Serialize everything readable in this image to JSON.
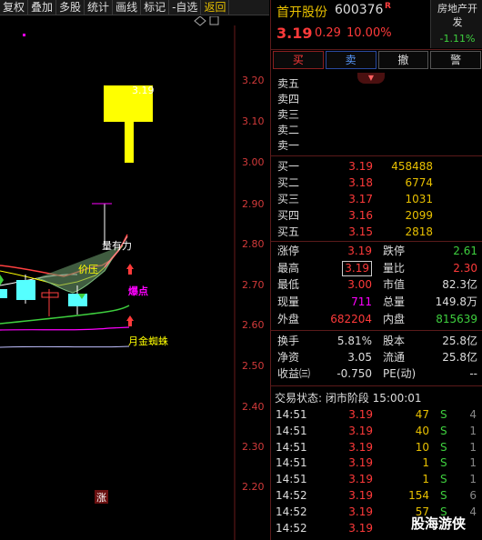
{
  "toolbar": {
    "items": [
      "复权",
      "叠加",
      "多股",
      "统计",
      "画线",
      "标记",
      "-自选",
      "返回"
    ]
  },
  "chart": {
    "price_labels": [
      "3.20",
      "3.10",
      "3.00",
      "2.90",
      "2.80",
      "2.70",
      "2.60",
      "2.50",
      "2.40",
      "2.30",
      "2.20"
    ],
    "high_label": "3.19",
    "annotations": {
      "volume": "量有力",
      "pressure": "价压",
      "burst": "爆点",
      "spider": "月金蜘蛛",
      "limit_up": "涨"
    },
    "colors": {
      "up_candle": "#ffff00",
      "down_candle": "#55ffff",
      "magenta": "#ff00ff"
    }
  },
  "header": {
    "name": "首开股份",
    "code": "600376",
    "badge": "R",
    "price": "3.19",
    "change": "0.29",
    "change_pct": "10.00%",
    "sector_name": "房地产开发",
    "sector_pct": "-1.11%"
  },
  "actions": {
    "buy": "买",
    "sell": "卖",
    "cancel": "撤",
    "alert": "警"
  },
  "asks": [
    {
      "label": "卖五",
      "price": "",
      "vol": ""
    },
    {
      "label": "卖四",
      "price": "",
      "vol": ""
    },
    {
      "label": "卖三",
      "price": "",
      "vol": ""
    },
    {
      "label": "卖二",
      "price": "",
      "vol": ""
    },
    {
      "label": "卖一",
      "price": "",
      "vol": ""
    }
  ],
  "bids": [
    {
      "label": "买一",
      "price": "3.19",
      "vol": "458488"
    },
    {
      "label": "买二",
      "price": "3.18",
      "vol": "6774"
    },
    {
      "label": "买三",
      "price": "3.17",
      "vol": "1031"
    },
    {
      "label": "买四",
      "price": "3.16",
      "vol": "2099"
    },
    {
      "label": "买五",
      "price": "3.15",
      "vol": "2818"
    }
  ],
  "stats": {
    "limit_up_label": "涨停",
    "limit_up": "3.19",
    "limit_down_label": "跌停",
    "limit_down": "2.61",
    "high_label": "最高",
    "high": "3.19",
    "vol_ratio_label": "量比",
    "vol_ratio": "2.30",
    "low_label": "最低",
    "low": "3.00",
    "mcap_label": "市值",
    "mcap": "82.3亿",
    "cur_vol_label": "现量",
    "cur_vol": "711",
    "total_vol_label": "总量",
    "total_vol": "149.8万",
    "outer_label": "外盘",
    "outer": "682204",
    "inner_label": "内盘",
    "inner": "815639",
    "turnover_label": "换手",
    "turnover": "5.81%",
    "shares_label": "股本",
    "shares": "25.8亿",
    "nav_label": "净资",
    "nav": "3.05",
    "float_label": "流通",
    "float": "25.8亿",
    "eps_label": "收益㈢",
    "eps": "-0.750",
    "pe_label": "PE(动)",
    "pe": "--"
  },
  "trade_status": "交易状态: 闭市阶段 15:00:01",
  "ticks": [
    {
      "time": "14:51",
      "price": "3.19",
      "vol": "47",
      "side": "S",
      "num": "4"
    },
    {
      "time": "14:51",
      "price": "3.19",
      "vol": "40",
      "side": "S",
      "num": "1"
    },
    {
      "time": "14:51",
      "price": "3.19",
      "vol": "10",
      "side": "S",
      "num": "1"
    },
    {
      "time": "14:51",
      "price": "3.19",
      "vol": "1",
      "side": "S",
      "num": "1"
    },
    {
      "time": "14:51",
      "price": "3.19",
      "vol": "1",
      "side": "S",
      "num": "1"
    },
    {
      "time": "14:52",
      "price": "3.19",
      "vol": "154",
      "side": "S",
      "num": "6"
    },
    {
      "time": "14:52",
      "price": "3.19",
      "vol": "57",
      "side": "S",
      "num": "4"
    },
    {
      "time": "14:52",
      "price": "3.19",
      "vol": "",
      "side": "",
      "num": ""
    }
  ],
  "watermark": "股海游侠"
}
